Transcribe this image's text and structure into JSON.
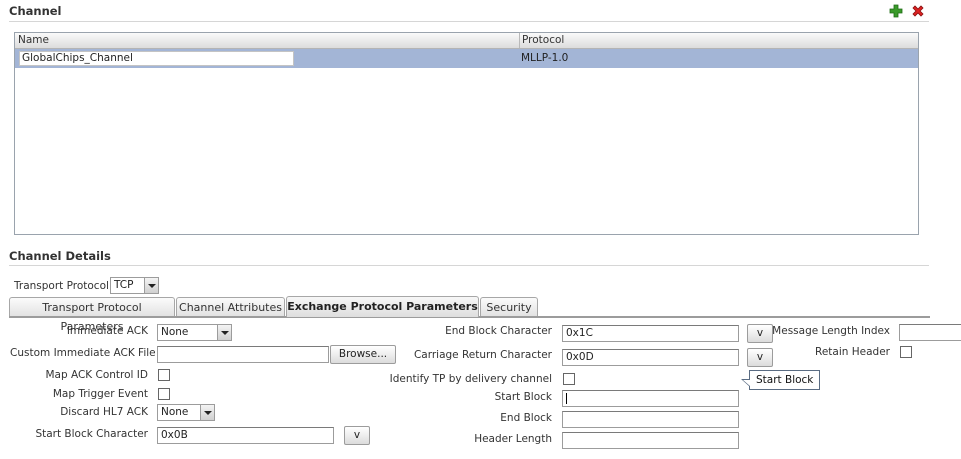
{
  "channel": {
    "title": "Channel",
    "add_icon": "plus-icon",
    "delete_icon": "delete-x-icon",
    "columns": [
      "Name",
      "Protocol"
    ],
    "rows": [
      {
        "name": "GlobalChips_Channel",
        "protocol": "MLLP-1.0"
      }
    ]
  },
  "details": {
    "title": "Channel Details",
    "transport_protocol_label": "Transport Protocol",
    "transport_protocol_value": "TCP",
    "tabs": [
      {
        "label": "Transport Protocol Parameters"
      },
      {
        "label": "Channel Attributes"
      },
      {
        "label": "Exchange Protocol Parameters"
      },
      {
        "label": "Security"
      }
    ]
  },
  "form": {
    "immediate_ack_label": "Immediate ACK",
    "immediate_ack_value": "None",
    "custom_ack_file_label": "Custom Immediate ACK File",
    "custom_ack_file_value": "",
    "browse_label": "Browse...",
    "map_ack_label": "Map ACK Control ID",
    "map_trigger_label": "Map Trigger Event",
    "discard_hl7_label": "Discard HL7 ACK",
    "discard_hl7_value": "None",
    "start_block_char_label": "Start Block Character",
    "start_block_char_value": "0x0B",
    "v_label": "v",
    "end_block_char_label": "End Block Character",
    "end_block_char_value": "0x1C",
    "carriage_return_label": "Carriage Return Character",
    "carriage_return_value": "0x0D",
    "identify_tp_label": "Identify TP by delivery channel",
    "start_block_label": "Start Block",
    "start_block_value": "",
    "end_block_label": "End Block",
    "end_block_value": "",
    "header_length_label": "Header Length",
    "header_length_value": "",
    "message_length_label": "Message Length Index",
    "message_length_value": "",
    "retain_header_label": "Retain Header"
  },
  "tooltip": {
    "text": "Start Block"
  }
}
